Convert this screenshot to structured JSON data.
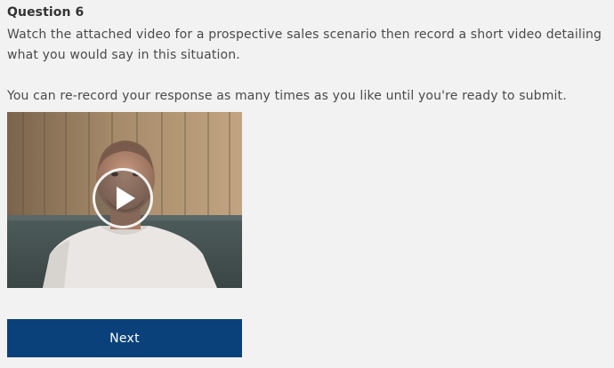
{
  "question": {
    "title": "Question 6",
    "line1": "Watch the attached video for a prospective sales scenario then record a short video detailing what you would say in this situation.",
    "line2": "You can re-record your response as many times as you like until you're ready to submit."
  },
  "video": {
    "play_icon": "play-icon"
  },
  "actions": {
    "next_label": "Next"
  },
  "colors": {
    "background": "#f2f2f2",
    "button": "#0a417a",
    "button_text": "#ffffff"
  }
}
